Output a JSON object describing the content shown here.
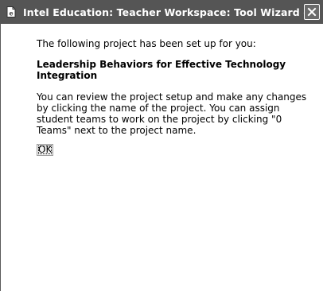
{
  "window": {
    "title": "Intel Education: Teacher Workspace: Tool Wizard -- W..."
  },
  "dialog": {
    "intro": "The following project has been set up for you:",
    "project_name": "Leadership Behaviors for Effective Technology Integration",
    "description": "You can review the project setup and make any changes by clicking the name of the project. You can assign student teams to work on the project by clicking \"0 Teams\" next to the project name.",
    "ok_label": "OK"
  },
  "icons": {
    "app": "ie-page-icon",
    "close": "close-icon"
  },
  "colors": {
    "titlebar": "#555555",
    "background": "#ffffff"
  }
}
